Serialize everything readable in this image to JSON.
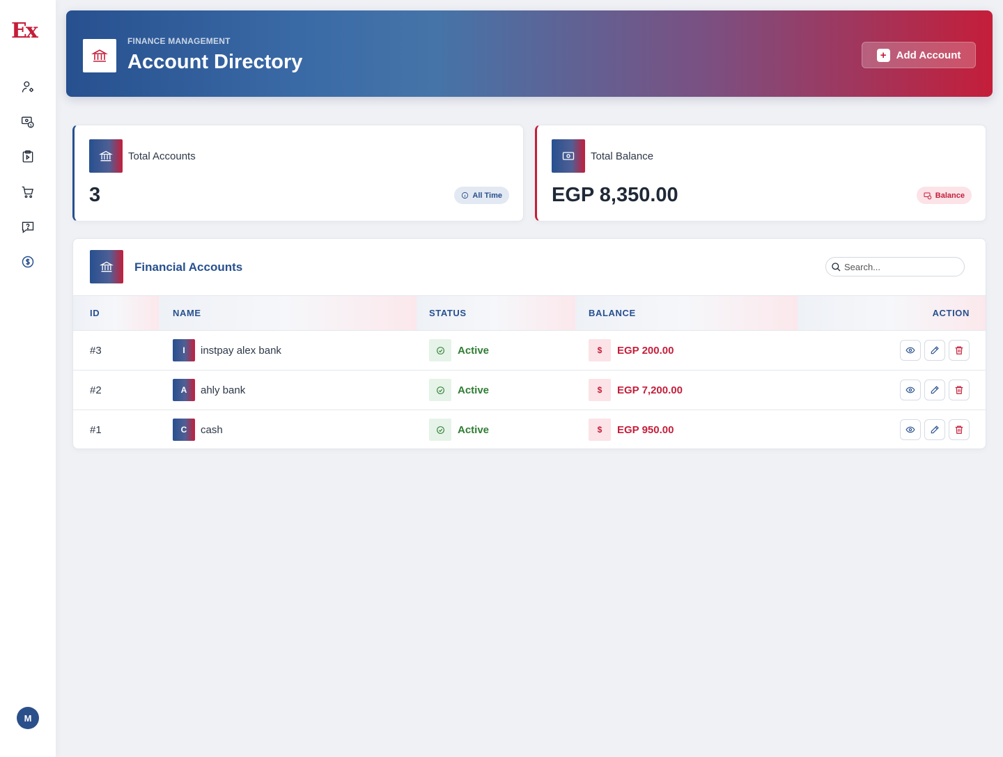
{
  "app": {
    "logo": "Ex",
    "user_initial": "M"
  },
  "sidebar": {
    "items": [
      {
        "icon": "user-gear-icon"
      },
      {
        "icon": "money-transfer-icon"
      },
      {
        "icon": "clipboard-icon"
      },
      {
        "icon": "cart-icon"
      },
      {
        "icon": "help-chat-icon"
      },
      {
        "icon": "dollar-circle-icon",
        "active": true
      }
    ]
  },
  "header": {
    "subtitle": "FINANCE MANAGEMENT",
    "title": "Account Directory",
    "add_button": "Add Account"
  },
  "stats": {
    "total_accounts": {
      "label": "Total Accounts",
      "value": "3",
      "pill": "All Time"
    },
    "total_balance": {
      "label": "Total Balance",
      "value": "EGP 8,350.00",
      "pill": "Balance"
    }
  },
  "table": {
    "title": "Financial Accounts",
    "search_placeholder": "Search...",
    "columns": {
      "id": "ID",
      "name": "NAME",
      "status": "STATUS",
      "balance": "BALANCE",
      "action": "ACTION"
    },
    "rows": [
      {
        "id": "#3",
        "initial": "I",
        "name": "instpay alex bank",
        "status": "Active",
        "currency_symbol": "$",
        "balance": "EGP 200.00"
      },
      {
        "id": "#2",
        "initial": "A",
        "name": "ahly bank",
        "status": "Active",
        "currency_symbol": "$",
        "balance": "EGP 7,200.00"
      },
      {
        "id": "#1",
        "initial": "C",
        "name": "cash",
        "status": "Active",
        "currency_symbol": "$",
        "balance": "EGP 950.00"
      }
    ]
  },
  "colors": {
    "primary": "#27508f",
    "accent": "#c41e3a",
    "success": "#2e7d32"
  }
}
